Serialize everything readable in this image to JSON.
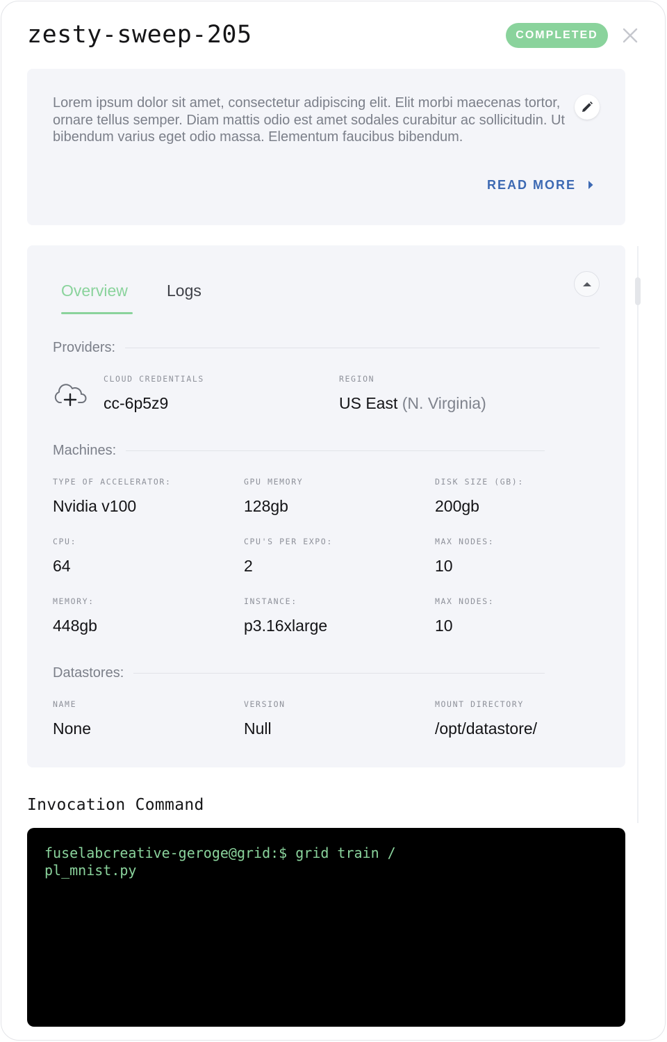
{
  "header": {
    "title": "zesty-sweep-205",
    "status": "COMPLETED"
  },
  "description": {
    "text": "Lorem ipsum dolor sit amet, consectetur adipiscing elit. Elit morbi maecenas tortor, ornare tellus semper. Diam mattis odio est amet sodales curabitur ac sollicitudin. Ut bibendum varius eget odio massa. Elementum faucibus bibendum.",
    "read_more": "READ MORE"
  },
  "tabs": [
    {
      "label": "Overview",
      "active": true
    },
    {
      "label": "Logs",
      "active": false
    }
  ],
  "providers": {
    "label": "Providers:",
    "cloud_credentials_label": "CLOUD CREDENTIALS",
    "cloud_credentials_value": "cc-6p5z9",
    "region_label": "REGION",
    "region_value": "US East",
    "region_detail": "(N. Virginia)"
  },
  "machines": {
    "label": "Machines:",
    "fields": [
      {
        "label": "TYPE OF ACCELERATOR:",
        "value": "Nvidia v100"
      },
      {
        "label": "GPU MEMORY",
        "value": "128gb"
      },
      {
        "label": "DISK SIZE (GB):",
        "value": "200gb"
      },
      {
        "label": "CPU:",
        "value": "64"
      },
      {
        "label": "CPU'S PER EXPO:",
        "value": "2"
      },
      {
        "label": "MAX NODES:",
        "value": "10"
      },
      {
        "label": "MEMORY:",
        "value": "448gb"
      },
      {
        "label": "INSTANCE:",
        "value": "p3.16xlarge"
      },
      {
        "label": "MAX NODES:",
        "value": "10"
      }
    ]
  },
  "datastores": {
    "label": "Datastores:",
    "fields": [
      {
        "label": "NAME",
        "value": "None"
      },
      {
        "label": "VERSION",
        "value": "Null"
      },
      {
        "label": "MOUNT DIRECTORY",
        "value": "/opt/datastore/"
      }
    ]
  },
  "invocation": {
    "title": "Invocation Command",
    "command": "fuselabcreative-geroge@grid:$ grid train /\npl_mnist.py"
  },
  "colors": {
    "accent_green": "#8ad39c",
    "link_blue": "#3c69b3",
    "card_bg": "#f4f5f9",
    "terminal_bg": "#000000"
  },
  "icons": [
    "close-icon",
    "edit-icon",
    "chevron-right-icon",
    "chevron-up-icon",
    "cloud-plus-icon"
  ]
}
